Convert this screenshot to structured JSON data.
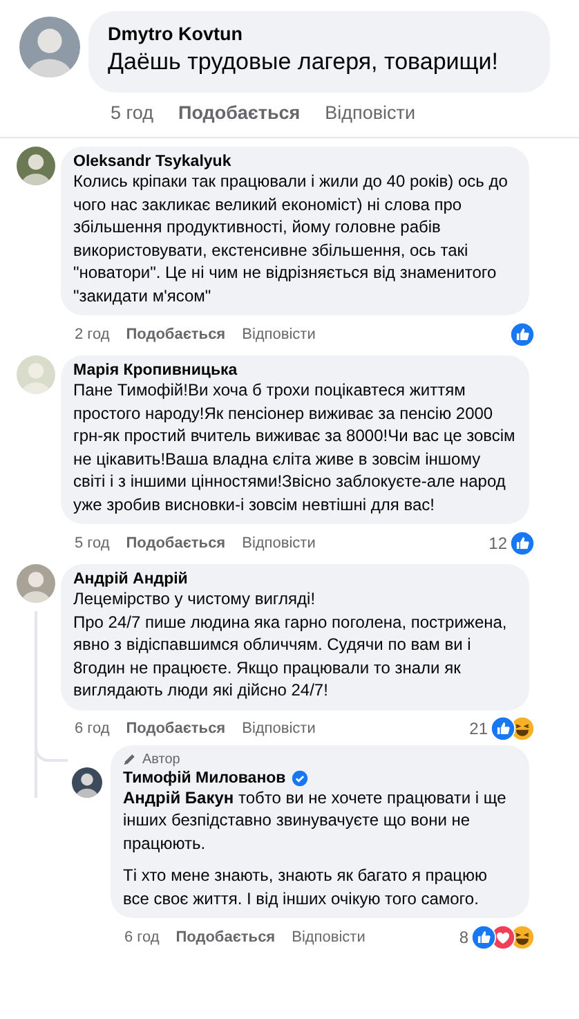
{
  "comments": [
    {
      "kind": "large",
      "author": "Dmytro Kovtun",
      "paragraphs": [
        "Даёшь трудовые лагеря, товарищи!"
      ],
      "time": "5 год",
      "like": "Подобається",
      "reply": "Відповісти"
    },
    {
      "kind": "normal",
      "author": "Oleksandr Tsykalyuk",
      "paragraphs": [
        "Колись кріпаки так працювали і жили до 40 років) ось до чого нас закликає великий економіст) ні слова про збільшення продуктивності, йому головне рабів використовувати, екстенсивне збільшення, ось такі \"новатори\". Це ні чим не відрізняється від знаменитого \"закидати м'ясом\""
      ],
      "time": "2 год",
      "like": "Подобається",
      "reply": "Відповісти",
      "reactions": [
        {
          "kind": "like"
        }
      ]
    },
    {
      "kind": "normal",
      "author": "Марія Кропивницька",
      "paragraphs": [
        "Пане Тимофій!Ви хоча б трохи поцікавтеся життям простого народу!Як пенсіонер виживає за пенсію 2000 грн-як простий вчитель виживає за 8000!Чи вас це зовсім не цікавить!Ваша владна єліта живе в зовсім іншому світі і з іншими цінностями!Звісно заблокуєте-але народ уже зробив висновки-і зовсім невтішні для вас!"
      ],
      "time": "5 год",
      "like": "Подобається",
      "reply": "Відповісти",
      "count": "12",
      "reactions": [
        {
          "kind": "like"
        }
      ]
    },
    {
      "kind": "normal",
      "author": "Андрій Андрій",
      "paragraphs": [
        "Лецемірство у чистому вигляді!\nПро 24/7 пише людина яка гарно поголена, пострижена, явно з відіспавшимся обличчям. Судячи по вам ви і 8годин не працюєте. Якщо працювали то знали як виглядають люди які дійсно 24/7!"
      ],
      "time": "6 год",
      "like": "Подобається",
      "reply": "Відповісти",
      "count": "21",
      "reactions": [
        {
          "kind": "like"
        },
        {
          "kind": "haha"
        }
      ],
      "replies": [
        {
          "kind": "reply",
          "badge": "Автор",
          "author": "Тимофій Милованов",
          "verified": true,
          "paragraphs": [
            "**Андрій Бакун** тобто ви не хочете працювати і ще інших безпідставно звинувачуєте що вони не працюють.",
            "Ті хто мене знають, знають як багато я працюю все своє життя. І від інших очікую того самого."
          ],
          "time": "6 год",
          "like": "Подобається",
          "reply": "Відповісти",
          "count": "8",
          "reactions": [
            {
              "kind": "like"
            },
            {
              "kind": "love"
            },
            {
              "kind": "haha"
            }
          ]
        }
      ]
    }
  ]
}
